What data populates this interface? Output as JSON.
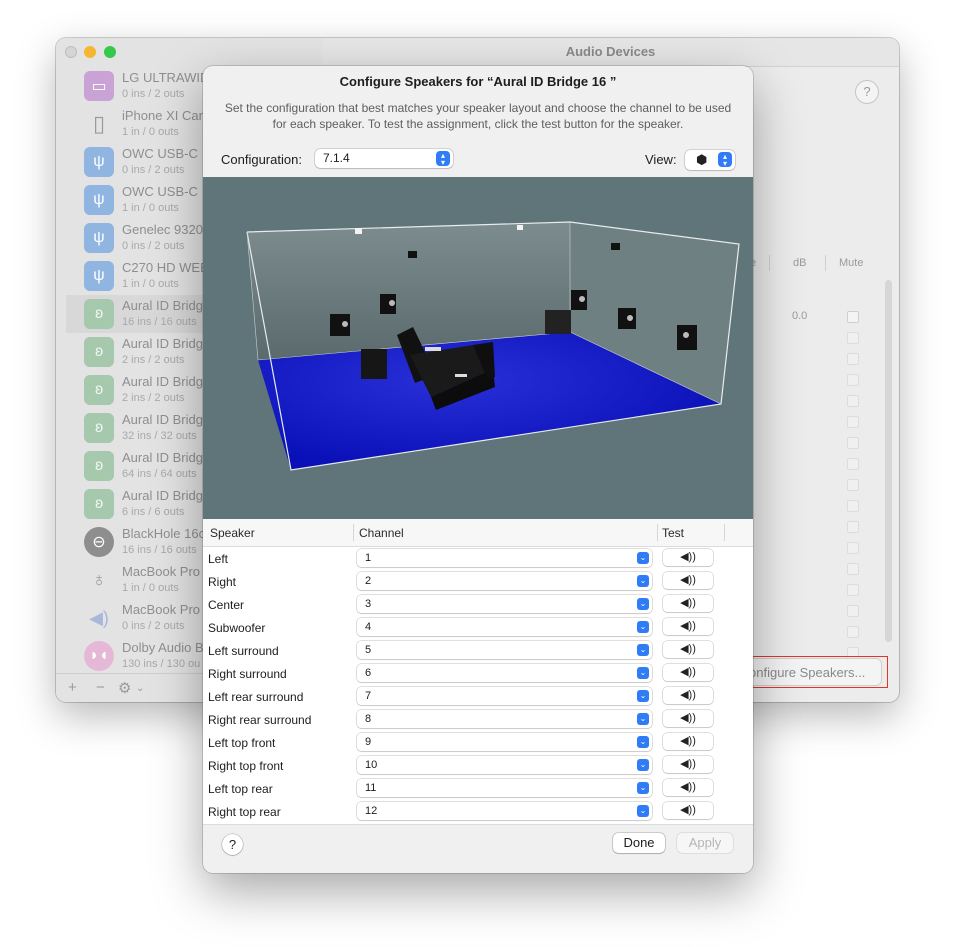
{
  "window": {
    "title": "Audio Devices",
    "help": "?",
    "columns": [
      "e",
      "dB",
      "Mute"
    ],
    "db_value": "0.0",
    "configure_button": "onfigure Speakers..."
  },
  "sidebar": {
    "devices": [
      {
        "name": "LG ULTRAWID",
        "sub": "0 ins / 2 outs",
        "icon": "monitor-icon"
      },
      {
        "name": "iPhone XI Car",
        "sub": "1 in / 0 outs",
        "icon": "phone-icon"
      },
      {
        "name": "OWC USB-C",
        "sub": "0 ins / 2 outs",
        "icon": "usb-icon"
      },
      {
        "name": "OWC USB-C",
        "sub": "1 in / 0 outs",
        "icon": "usb-icon"
      },
      {
        "name": "Genelec 9320",
        "sub": "0 ins / 2 outs",
        "icon": "usb-icon"
      },
      {
        "name": "C270 HD WEB",
        "sub": "1 in / 0 outs",
        "icon": "usb-icon"
      },
      {
        "name": "Aural ID Bridg",
        "sub": "16 ins / 16 outs",
        "icon": "ear-icon"
      },
      {
        "name": "Aural ID Bridg",
        "sub": "2 ins / 2 outs",
        "icon": "ear-icon"
      },
      {
        "name": "Aural ID Bridg",
        "sub": "2 ins / 2 outs",
        "icon": "ear-icon"
      },
      {
        "name": "Aural ID Bridg",
        "sub": "32 ins / 32 outs",
        "icon": "ear-icon"
      },
      {
        "name": "Aural ID Bridg",
        "sub": "64 ins / 64 outs",
        "icon": "ear-icon"
      },
      {
        "name": "Aural ID Bridg",
        "sub": "6 ins / 6 outs",
        "icon": "ear-icon"
      },
      {
        "name": "BlackHole 16c",
        "sub": "16 ins / 16 outs",
        "icon": "blackhole-icon"
      },
      {
        "name": "MacBook Pro",
        "sub": "1 in / 0 outs",
        "icon": "microphone-icon"
      },
      {
        "name": "MacBook Pro",
        "sub": "0 ins / 2 outs",
        "icon": "speaker-wave-icon"
      },
      {
        "name": "Dolby Audio B",
        "sub": "130 ins / 130 ou",
        "icon": "dolby-icon"
      }
    ],
    "footer": {
      "add": "+",
      "remove": "−",
      "gear": "⚙"
    }
  },
  "dialog": {
    "title": "Configure Speakers for “Aural ID Bridge 16 ”",
    "description": "Set the configuration that best matches your speaker layout and choose the channel to be used for each speaker. To test the assignment, click the test button for the speaker.",
    "configuration_label": "Configuration:",
    "configuration_value": "7.1.4",
    "view_label": "View:",
    "columns": {
      "speaker": "Speaker",
      "channel": "Channel",
      "test": "Test"
    },
    "speakers": [
      {
        "name": "Left",
        "channel": "1"
      },
      {
        "name": "Right",
        "channel": "2"
      },
      {
        "name": "Center",
        "channel": "3"
      },
      {
        "name": "Subwoofer",
        "channel": "4"
      },
      {
        "name": "Left surround",
        "channel": "5"
      },
      {
        "name": "Right surround",
        "channel": "6"
      },
      {
        "name": "Left rear surround",
        "channel": "7"
      },
      {
        "name": "Right rear surround",
        "channel": "8"
      },
      {
        "name": "Left top front",
        "channel": "9"
      },
      {
        "name": "Right top front",
        "channel": "10"
      },
      {
        "name": "Left top rear",
        "channel": "11"
      },
      {
        "name": "Right top rear",
        "channel": "12"
      }
    ],
    "test_icon": "speaker-icon",
    "help": "?",
    "done": "Done",
    "apply": "Apply"
  },
  "colors": {
    "accent": "#2f7cf6",
    "floor": "#0a10b8",
    "scene_bg": "#5f7579",
    "highlight": "#e5332a"
  }
}
